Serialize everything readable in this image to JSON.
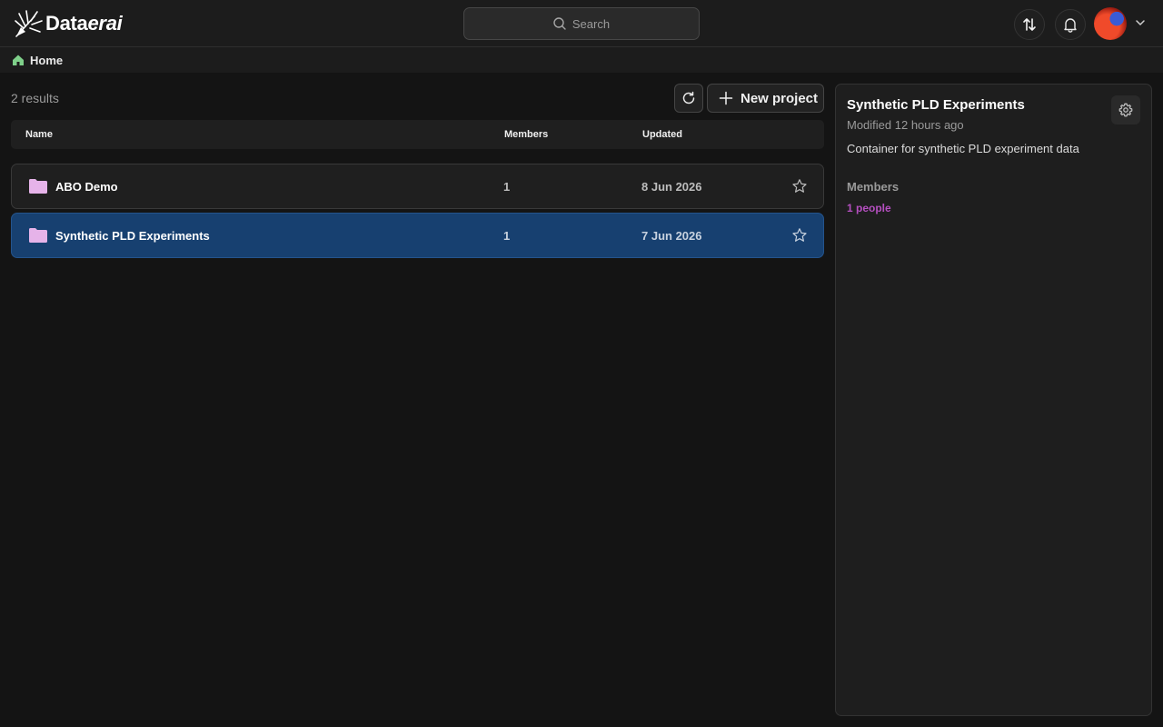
{
  "app": {
    "logo_prefix": "Data",
    "logo_suffix": "erai"
  },
  "search": {
    "label": "Search"
  },
  "topbar_icons": [
    "sort-icon",
    "bell-icon",
    "avatar",
    "chevron-down-icon"
  ],
  "breadcrumb": {
    "home_label": "Home",
    "home_icon_color": "#7fd08a"
  },
  "list": {
    "results_text": "2 results",
    "new_project_label": "New project",
    "columns": {
      "name": "Name",
      "members": "Members",
      "updated": "Updated"
    },
    "rows": [
      {
        "name": "ABO Demo",
        "members": "1",
        "updated": "8 Jun 2026",
        "selected": false,
        "starred": false
      },
      {
        "name": "Synthetic PLD Experiments",
        "members": "1",
        "updated": "7 Jun 2026",
        "selected": true,
        "starred": false
      }
    ]
  },
  "detail": {
    "title": "Synthetic PLD Experiments",
    "modified": "Modified 12 hours ago",
    "description": "Container for synthetic PLD experiment data",
    "members_label": "Members",
    "members_link": "1 people"
  },
  "colors": {
    "selected_row": "#174070",
    "folder_icon": "#e6b3e9",
    "link_purple": "#b54fc0",
    "background": "#141414"
  }
}
